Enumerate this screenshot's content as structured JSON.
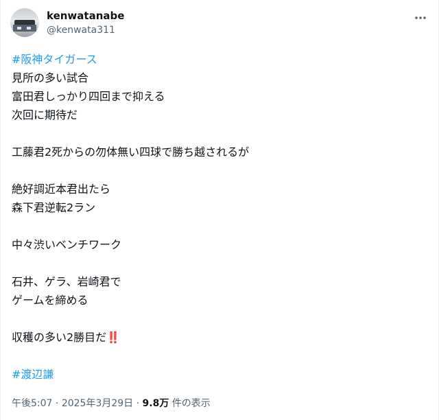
{
  "author": {
    "display_name": "kenwatanabe",
    "handle": "@kenwata311"
  },
  "post": {
    "lines": [
      {
        "type": "hashtag",
        "text": "#阪神タイガース"
      },
      {
        "type": "text",
        "text": "見所の多い試合"
      },
      {
        "type": "text",
        "text": "富田君しっかり四回まで抑える"
      },
      {
        "type": "text",
        "text": "次回に期待だ"
      },
      {
        "type": "blank",
        "text": ""
      },
      {
        "type": "text",
        "text": "工藤君2死からの勿体無い四球で勝ち越されるが"
      },
      {
        "type": "blank",
        "text": ""
      },
      {
        "type": "text",
        "text": "絶好調近本君出たら"
      },
      {
        "type": "text",
        "text": "森下君逆転2ラン"
      },
      {
        "type": "blank",
        "text": ""
      },
      {
        "type": "text",
        "text": "中々渋いベンチワーク"
      },
      {
        "type": "blank",
        "text": ""
      },
      {
        "type": "text",
        "text": "石井、ゲラ、岩崎君で"
      },
      {
        "type": "text",
        "text": "ゲームを締める"
      },
      {
        "type": "blank",
        "text": ""
      },
      {
        "type": "text",
        "text": "収穫の多い2勝目だ",
        "emoji": "‼️"
      },
      {
        "type": "blank",
        "text": ""
      },
      {
        "type": "hashtag",
        "text": "#渡辺謙"
      }
    ]
  },
  "meta": {
    "time": "午後5:07",
    "sep1": " · ",
    "date": "2025年3月29日",
    "sep2": " · ",
    "views_count": "9.8万",
    "views_label": " 件の表示"
  },
  "icons": {
    "more": "more-horizontal-icon",
    "avatar": "avatar"
  },
  "colors": {
    "hashtag": "#1d9bf0",
    "text": "#0f1419",
    "secondary": "#536471",
    "emoji": "#e0245e"
  }
}
